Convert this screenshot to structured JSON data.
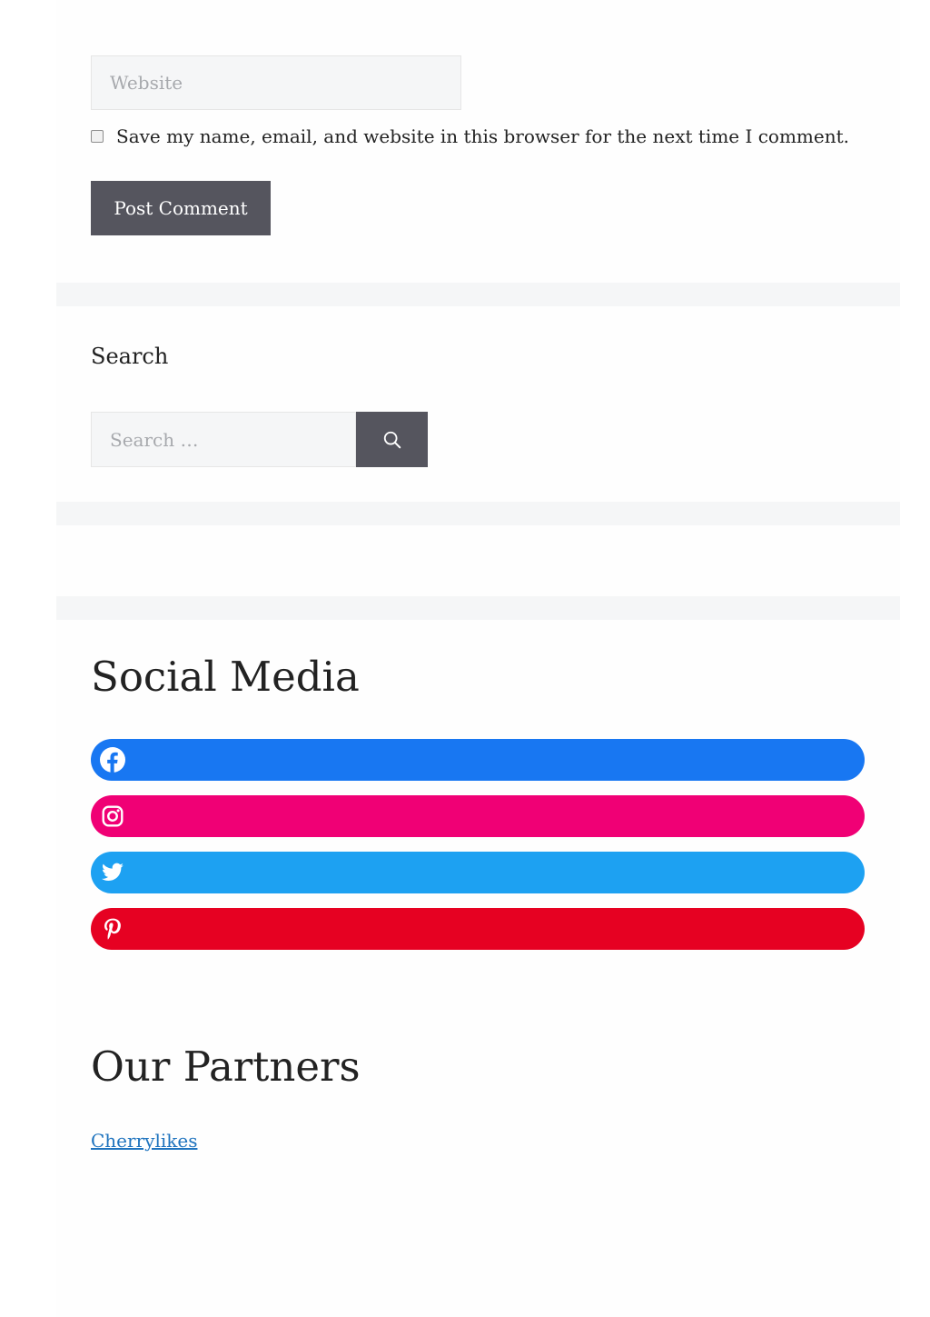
{
  "comment_form": {
    "website_placeholder": "Website",
    "cookie_consent_label": "Save my name, email, and website in this browser for the next time I comment.",
    "submit_label": "Post Comment"
  },
  "search_widget": {
    "heading": "Search",
    "placeholder": "Search …",
    "button_icon": "search-icon"
  },
  "social_media": {
    "heading": "Social Media",
    "links": [
      {
        "network": "facebook",
        "icon": "facebook-icon",
        "color": "#1877f2"
      },
      {
        "network": "instagram",
        "icon": "instagram-icon",
        "color": "#f00075"
      },
      {
        "network": "twitter",
        "icon": "twitter-icon",
        "color": "#1da1f2"
      },
      {
        "network": "pinterest",
        "icon": "pinterest-icon",
        "color": "#e60122"
      }
    ]
  },
  "partners": {
    "heading": "Our Partners",
    "links": [
      {
        "label": "Cherrylikes"
      }
    ]
  },
  "colors": {
    "button_bg": "#55555e",
    "input_bg": "#f5f6f7",
    "separator_bg": "#f5f6f7",
    "link": "#1e73be",
    "text": "#222222"
  }
}
